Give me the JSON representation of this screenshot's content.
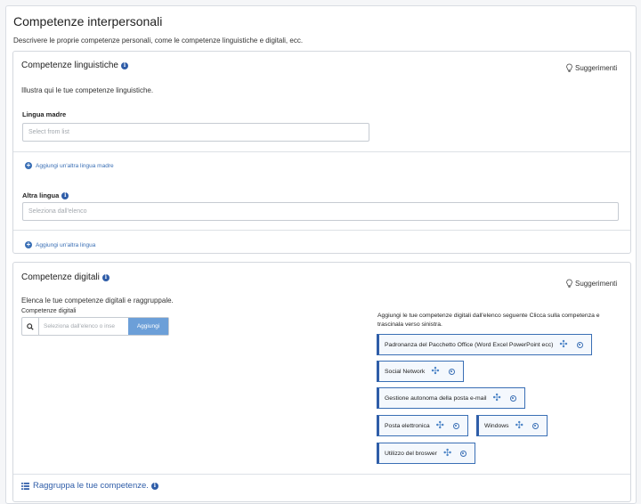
{
  "page": {
    "title": "Competenze interpersonali",
    "description": "Descrivere le proprie competenze personali, come le competenze linguistiche e digitali, ecc."
  },
  "linguistic": {
    "title": "Competenze linguistiche",
    "suggestions": "Suggerimenti",
    "description": "Illustra qui le tue competenze linguistiche.",
    "mother_label": "Lingua madre",
    "mother_placeholder": "Select from list",
    "add_mother": "Aggiungi un'altra lingua madre",
    "other_label": "Altra lingua",
    "other_placeholder": "Seleziona dall'elenco",
    "add_other": "Aggiungi un'altra lingua"
  },
  "digital": {
    "title": "Competenze digitali",
    "suggestions": "Suggerimenti",
    "description": "Elenca le tue competenze digitali e raggruppale.",
    "field_label": "Competenze digitali",
    "search_placeholder": "Seleziona dall'elenco o inse",
    "add_button": "Aggiungi",
    "hint": "Aggiungi le tue competenze digitali dall'elenco seguente Clicca sulla competenza e trascinala verso sinistra.",
    "chips": [
      "Padronanza del Pacchetto Office (Word Excel PowerPoint ecc)",
      "Social Network",
      "Gestione autonoma della posta e-mail",
      "Posta elettronica",
      "Windows",
      "Utilizzo del broswer"
    ],
    "group_title": "Raggruppa le tue competenze."
  },
  "icons": {
    "info": "info-icon",
    "bulb": "lightbulb-icon",
    "plus": "plus-circle-icon",
    "search": "search-icon",
    "move": "move-arrows-icon",
    "remove": "remove-circle-icon",
    "list": "list-icon"
  },
  "colors": {
    "accent": "#2f5da8",
    "link": "#3a6fb5",
    "button": "#6c9fd8"
  }
}
